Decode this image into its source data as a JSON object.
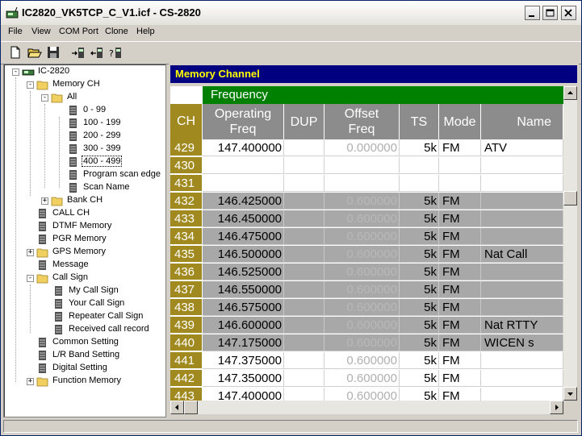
{
  "window": {
    "title": "IC2820_VK5TCP_C_V1.icf - CS-2820"
  },
  "menu": [
    "File",
    "View",
    "COM Port",
    "Clone",
    "Help"
  ],
  "toolbar": {
    "icons": [
      "new-file-icon",
      "open-folder-icon",
      "save-disk-icon",
      "write-to-radio-icon",
      "read-from-radio-icon",
      "clone-info-icon"
    ]
  },
  "tree": {
    "root": "IC-2820",
    "memory_ch": "Memory CH",
    "all": "All",
    "banks": [
      "0 - 99",
      "100 - 199",
      "200 - 299",
      "300 - 399",
      "400 - 499"
    ],
    "selected_bank": "400 - 499",
    "program_scan_edge": "Program scan edge",
    "scan_name": "Scan Name",
    "bank_ch": "Bank CH",
    "call_ch": "CALL CH",
    "dtmf_memory": "DTMF Memory",
    "pgr_memory": "PGR Memory",
    "gps_memory": "GPS Memory",
    "message": "Message",
    "call_sign": "Call Sign",
    "my_call_sign": "My Call Sign",
    "your_call_sign": "Your Call Sign",
    "repeater_call_sign": "Repeater Call Sign",
    "received_call_record": "Received call record",
    "common_setting": "Common Setting",
    "lr_band_setting": "L/R Band Setting",
    "digital_setting": "Digital Setting",
    "function_memory": "Function Memory"
  },
  "panel": {
    "title": "Memory Channel",
    "group_header": "Frequency",
    "columns": {
      "ch": "CH",
      "freq_line1": "Operating",
      "freq_line2": "Freq",
      "dup": "DUP",
      "offset_line1": "Offset",
      "offset_line2": "Freq",
      "ts": "TS",
      "mode": "Mode",
      "name": "Name"
    },
    "rows": [
      {
        "ch": "429",
        "freq": "147.400000",
        "dup": "",
        "offset": "0.000000",
        "ts": "5k",
        "mode": "FM",
        "name": "ATV",
        "shade": "w"
      },
      {
        "ch": "430",
        "freq": "",
        "dup": "",
        "offset": "",
        "ts": "",
        "mode": "",
        "name": "",
        "shade": "w"
      },
      {
        "ch": "431",
        "freq": "",
        "dup": "",
        "offset": "",
        "ts": "",
        "mode": "",
        "name": "",
        "shade": "w"
      },
      {
        "ch": "432",
        "freq": "146.425000",
        "dup": "",
        "offset": "0.600000",
        "ts": "5k",
        "mode": "FM",
        "name": "",
        "shade": "g"
      },
      {
        "ch": "433",
        "freq": "146.450000",
        "dup": "",
        "offset": "0.600000",
        "ts": "5k",
        "mode": "FM",
        "name": "",
        "shade": "g"
      },
      {
        "ch": "434",
        "freq": "146.475000",
        "dup": "",
        "offset": "0.600000",
        "ts": "5k",
        "mode": "FM",
        "name": "",
        "shade": "g"
      },
      {
        "ch": "435",
        "freq": "146.500000",
        "dup": "",
        "offset": "0.600000",
        "ts": "5k",
        "mode": "FM",
        "name": "Nat Call",
        "shade": "g"
      },
      {
        "ch": "436",
        "freq": "146.525000",
        "dup": "",
        "offset": "0.600000",
        "ts": "5k",
        "mode": "FM",
        "name": "",
        "shade": "g"
      },
      {
        "ch": "437",
        "freq": "146.550000",
        "dup": "",
        "offset": "0.600000",
        "ts": "5k",
        "mode": "FM",
        "name": "",
        "shade": "g"
      },
      {
        "ch": "438",
        "freq": "146.575000",
        "dup": "",
        "offset": "0.600000",
        "ts": "5k",
        "mode": "FM",
        "name": "",
        "shade": "g"
      },
      {
        "ch": "439",
        "freq": "146.600000",
        "dup": "",
        "offset": "0.600000",
        "ts": "5k",
        "mode": "FM",
        "name": "Nat RTTY",
        "shade": "g"
      },
      {
        "ch": "440",
        "freq": "147.175000",
        "dup": "",
        "offset": "0.600000",
        "ts": "5k",
        "mode": "FM",
        "name": "WICEN s",
        "shade": "g"
      },
      {
        "ch": "441",
        "freq": "147.375000",
        "dup": "",
        "offset": "0.600000",
        "ts": "5k",
        "mode": "FM",
        "name": "",
        "shade": "w"
      },
      {
        "ch": "442",
        "freq": "147.350000",
        "dup": "",
        "offset": "0.600000",
        "ts": "5k",
        "mode": "FM",
        "name": "",
        "shade": "w"
      },
      {
        "ch": "443",
        "freq": "147.400000",
        "dup": "",
        "offset": "0.600000",
        "ts": "5k",
        "mode": "FM",
        "name": "",
        "shade": "w"
      }
    ]
  },
  "colors": {
    "panel_title_bg": "#000080",
    "panel_title_text": "#ffff00",
    "freq_header": "#008000",
    "ch_column": "#a0891e",
    "header_gray": "#8c8c8c",
    "row_gray": "#a8a8a8"
  }
}
